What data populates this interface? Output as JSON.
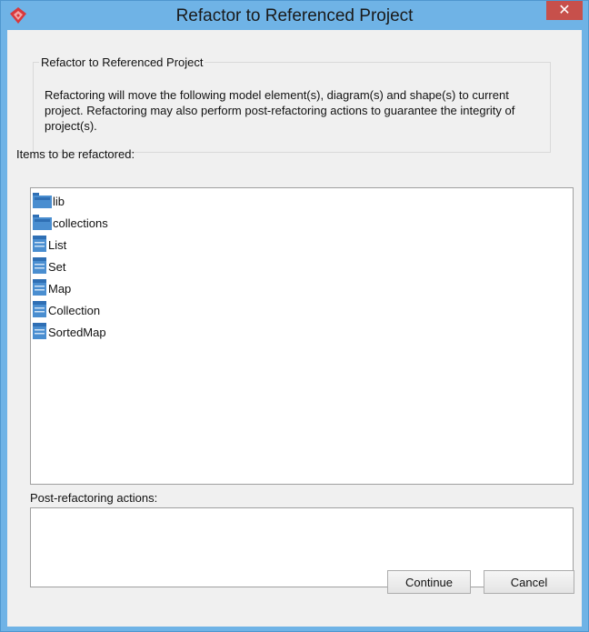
{
  "window": {
    "title": "Refactor to Referenced Project",
    "close_label": "✕",
    "icons": {
      "app": "vp-logo-icon",
      "close": "close-icon"
    }
  },
  "group": {
    "legend": "Refactor to Referenced Project",
    "description": "Refactoring will move the following model element(s), diagram(s) and shape(s) to current project. Refactoring may also perform post-refactoring actions to guarantee the integrity of project(s)."
  },
  "items_section": {
    "label": "Items to be refactored:",
    "items": [
      {
        "label": "lib",
        "icon": "package-icon"
      },
      {
        "label": "collections",
        "icon": "package-icon"
      },
      {
        "label": "List",
        "icon": "class-icon"
      },
      {
        "label": "Set",
        "icon": "class-icon"
      },
      {
        "label": "Map",
        "icon": "class-icon"
      },
      {
        "label": "Collection",
        "icon": "class-icon"
      },
      {
        "label": "SortedMap",
        "icon": "class-icon"
      }
    ]
  },
  "actions_section": {
    "label": "Post-refactoring actions:"
  },
  "buttons": {
    "continue": "Continue",
    "cancel": "Cancel"
  },
  "colors": {
    "titlebar": "#6fb3e6",
    "close_button": "#c7504b",
    "dialog_background": "#f0f0f0",
    "icon_blue": "#4a8ed0"
  }
}
